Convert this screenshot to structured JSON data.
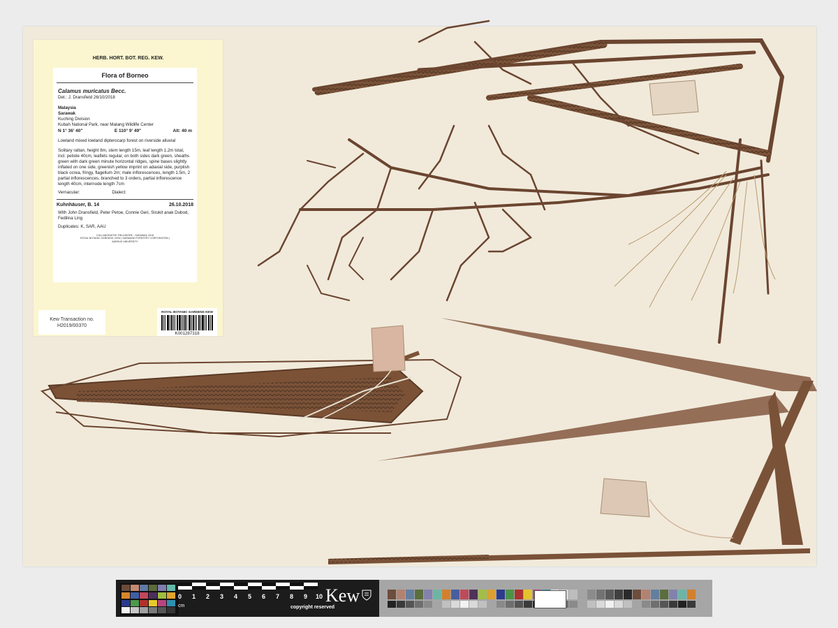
{
  "label": {
    "header": "HERB. HORT. BOT. REG. KEW.",
    "flora": "Flora of Borneo",
    "taxon": "Calamus  muricatus  Becc.",
    "det": "Det.: J. Dransfield 26/10/2018",
    "country": "Malaysia",
    "state": "Sarawak",
    "division": "Kuching Division",
    "locality": "Kubah National Park, near Matang Wildlife Center",
    "lat": "N 1° 36' 40\"",
    "lon": "E 110° 9' 49\"",
    "alt": "Alt: 40 m",
    "habitat": "Lowland mixed lowland dipterocarp forest on riverside alluvial",
    "description": "Solitary rattan, height 8m, stem length 15m, leaf length 1.2m total, incl. petiole 40cm, leaflets regular, on both sides dark green, sheaths green with dark green minute horizontal ridges, spine bases slightly inflated on one side, greenish yellow imprint on adaxial side, purplish black ocrea, fringy, flagellum 2m; male inflorescences, length 1.5m, 2 partial inflorescences, branched to 3 orders, partial inflorescence length 40cm, internode length 7cm",
    "vernacular": "Vernacular:",
    "dialect": "Dialect:",
    "collector": "Kuhnhäuser, B.  14",
    "date": "26.10.2018",
    "with": "With John Dransfield, Peter Petoe, Connie Geri, Sirukit anak Dubod, Fedilina Ling",
    "duplicates": "Duplicates: K, SAR, AAU",
    "footer_line1": "COLLABORATIVE FIELDWORK - SARAWAK 2018",
    "footer_line2": "ROYAL BOTANIC GARDENS, KEW | SARAWAK FORESTRY CORPORATION |",
    "footer_line3": "AARHUS UNIVERSITY"
  },
  "transaction": {
    "line1": "Kew Transaction no.",
    "line2": "H2019/00370"
  },
  "barcode": {
    "header": "ROYAL BOTANIC GARDENS KEW",
    "number": "K001287318"
  },
  "scale_bar": {
    "ruler_numbers": [
      "0",
      "1",
      "2",
      "3",
      "4",
      "5",
      "6",
      "7",
      "8",
      "9",
      "10"
    ],
    "unit": "cm",
    "copyright": "copyright reserved",
    "logo": "Kew",
    "top_swatches": [
      "#6b4a3a",
      "#c48a72",
      "#5f7aa3",
      "#5c6b3c",
      "#7f7db0",
      "#63b8a9",
      "#d7862e",
      "#3f5fa5",
      "#c2475a",
      "#4d2f5c",
      "#9fbd3e",
      "#e0a32d",
      "#2b3a8f",
      "#4d9a4a",
      "#b3302d",
      "#e8c92b",
      "#b7457e",
      "#2f8fb0"
    ],
    "bottom_swatches": [
      "#f3f3f3",
      "#c8c8c8",
      "#a0a0a0",
      "#7a7a7a",
      "#555555",
      "#333333"
    ],
    "color_strip": [
      "#6d4d3c",
      "#b28271",
      "#647e9e",
      "#5b6e3d",
      "#8381ad",
      "#6bb5a6",
      "#d2802d",
      "#475fa0",
      "#bd4a5a",
      "#4e3259",
      "#a3be45",
      "#dba033",
      "#2d3b8c",
      "#4a9447",
      "#a93330",
      "#e2c32f",
      "#b04a80",
      "#3a8aa9",
      "#efefef",
      "#d6d6d6",
      "#bdbdbd",
      "#a4a4a4",
      "#8b8b8b",
      "#727272",
      "#595959",
      "#404040",
      "#2a2a2a",
      "#6d4d3c",
      "#b28271",
      "#647e9e",
      "#5b6e3d",
      "#8381ad",
      "#6bb5a6",
      "#d2802d"
    ],
    "gray_strip": [
      "#222",
      "#3a3a3a",
      "#555",
      "#6f6f6f",
      "#8a8a8a",
      "#a5a5a5",
      "#c0c0c0",
      "#dadada",
      "#f2f2f2",
      "#dadada",
      "#c0c0c0",
      "#a5a5a5",
      "#8a8a8a",
      "#6f6f6f",
      "#555",
      "#3a3a3a",
      "#222",
      "#3a3a3a",
      "#555",
      "#6f6f6f",
      "#8a8a8a",
      "#a5a5a5",
      "#c0c0c0",
      "#dadada",
      "#f2f2f2",
      "#dadada",
      "#c0c0c0",
      "#a5a5a5",
      "#8a8a8a",
      "#6f6f6f",
      "#555",
      "#3a3a3a",
      "#222",
      "#3a3a3a"
    ]
  }
}
